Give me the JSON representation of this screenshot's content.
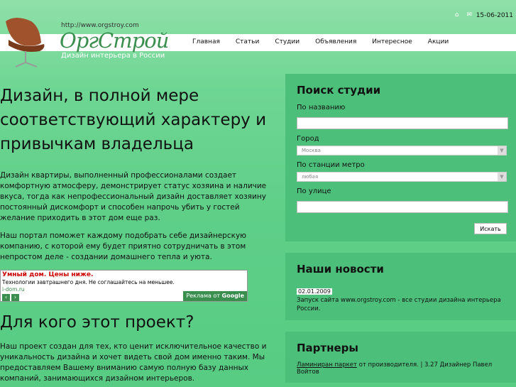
{
  "header": {
    "url": "http://www.orgstroy.com",
    "date": "15-06-2011",
    "logo": "ОргСтрой",
    "tagline": "Дизайн интерьера в России"
  },
  "nav": [
    "Главная",
    "Статьи",
    "Студии",
    "Объявления",
    "Интересное",
    "Акции"
  ],
  "main": {
    "hero": "Дизайн, в полной мере соответствующий характеру и привычкам владельца",
    "p1": "Дизайн квартиры, выполненный профессионалами создает комфортную атмосферу, демонстрирует статус хозяина и наличие вкуса, тогда как непрофессиональный дизайн доставляет хозяину постоянный дискомфорт и способен напрочь убить у гостей желание приходить в этот дом еще раз.",
    "p2": "Наш портал поможет каждому подобрать себе дизайнерскую компанию, с которой ему будет приятно сотрудничать в этом непростом деле - создании домашнего тепла и уюта.",
    "ad": {
      "title": "Умный дом. Цены ниже.",
      "text": "Технологии завтрашнего дня. Не соглашайтесь на меньшее.",
      "link": "i-dom.ru",
      "badge": "Реклама от",
      "brand": "Google"
    },
    "section_title": "Для кого этот проект?",
    "p3": "Наш проект создан для тех, кто ценит исключительное качество и уникальность дизайна и хочет видеть свой дом именно таким.",
    "p3b": "Мы предоставляем Вашему вниманию самую полную базу данных компаний, занимающихся дизайном интерьеров."
  },
  "search": {
    "title": "Поиск студии",
    "by_name": "По названию",
    "city": "Город",
    "city_value": "Москва",
    "metro": "По станции метро",
    "metro_value": "любая",
    "street": "По улице",
    "button": "Искать"
  },
  "news": {
    "title": "Наши новости",
    "date": "02.01.2009",
    "text": "Запуск сайта www.orgstroy.com - все студии дизайна интерьера России."
  },
  "partners": {
    "title": "Партнеры",
    "link": "Ламиниран паркет",
    "text": " от производителя. | 3.27 Дизайнер Павел Войтов"
  }
}
